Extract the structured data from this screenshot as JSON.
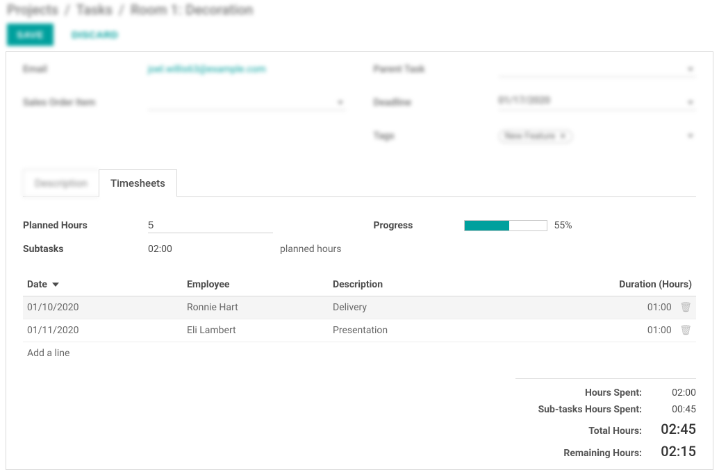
{
  "breadcrumb": {
    "l1": "Projects",
    "l2": "Tasks",
    "l3": "Room 1: Decoration"
  },
  "buttons": {
    "save": "SAVE",
    "discard": "DISCARD"
  },
  "fields": {
    "email_label": "Email",
    "email_value": "joel.willis63@example.com",
    "sales_order_label": "Sales Order Item",
    "parent_task_label": "Parent Task",
    "deadline_label": "Deadline",
    "deadline_value": "01/17/2020",
    "tags_label": "Tags",
    "tag_value": "New Feature"
  },
  "tabs": {
    "description": "Description",
    "timesheets": "Timesheets"
  },
  "timesheets": {
    "planned_hours_label": "Planned Hours",
    "planned_hours_value": "5",
    "subtasks_label": "Subtasks",
    "subtasks_value": "02:00",
    "subtasks_suffix": "planned hours",
    "progress_label": "Progress",
    "progress_percent": "55%",
    "progress_fill_pct": 55,
    "columns": {
      "date": "Date",
      "employee": "Employee",
      "description": "Description",
      "duration": "Duration (Hours)"
    },
    "rows": [
      {
        "date": "01/10/2020",
        "employee": "Ronnie Hart",
        "description": "Delivery",
        "duration": "01:00"
      },
      {
        "date": "01/11/2020",
        "employee": "Eli Lambert",
        "description": "Presentation",
        "duration": "01:00"
      }
    ],
    "add_line": "Add a line",
    "totals": {
      "hours_spent_label": "Hours Spent:",
      "hours_spent_value": "02:00",
      "subtasks_spent_label": "Sub-tasks Hours Spent:",
      "subtasks_spent_value": "00:45",
      "total_hours_label": "Total Hours:",
      "total_hours_value": "02:45",
      "remaining_label": "Remaining Hours:",
      "remaining_value": "02:15"
    }
  }
}
